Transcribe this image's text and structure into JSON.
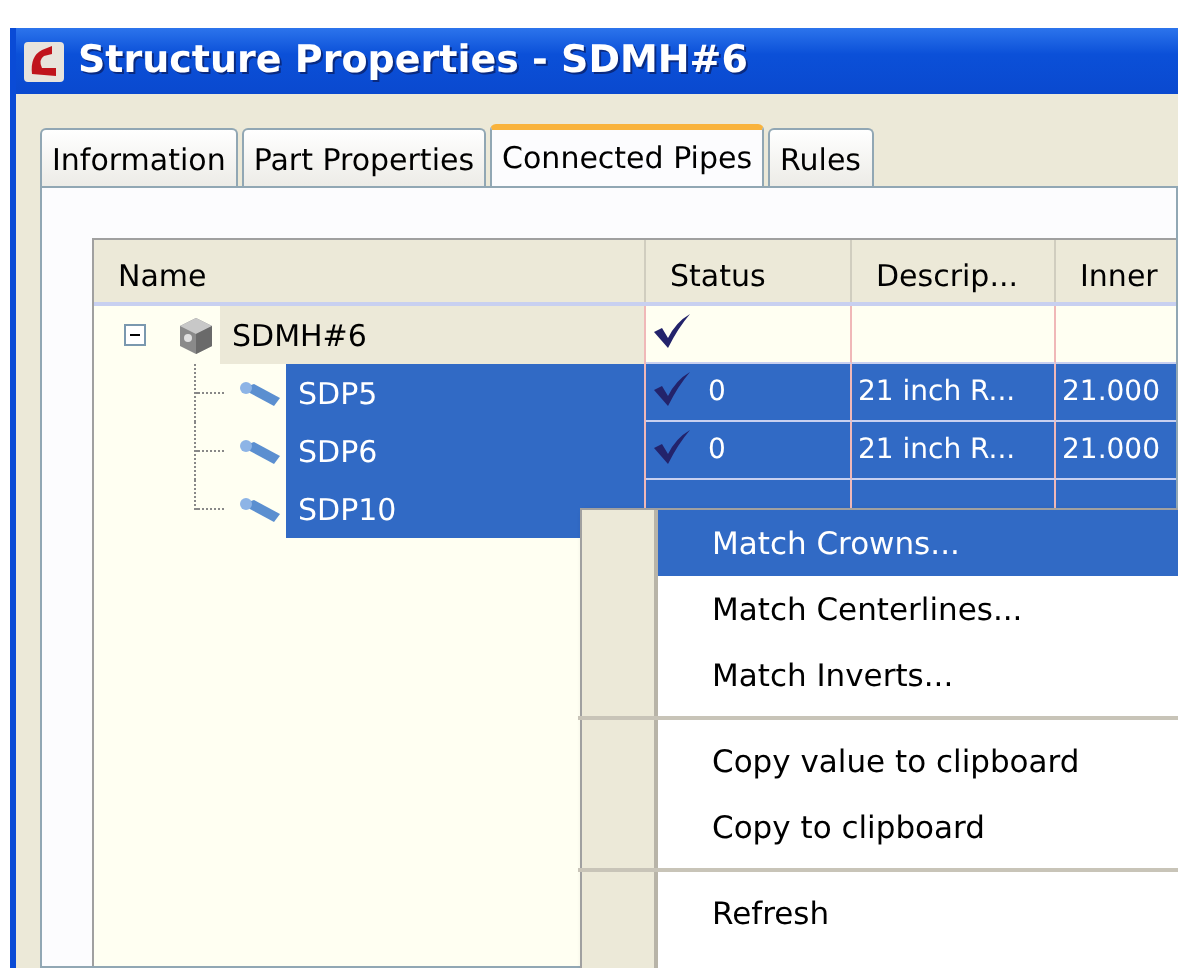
{
  "window": {
    "title": "Structure Properties - SDMH#6"
  },
  "tabs": [
    {
      "label": "Information",
      "selected": false
    },
    {
      "label": "Part Properties",
      "selected": false
    },
    {
      "label": "Connected Pipes",
      "selected": true
    },
    {
      "label": "Rules",
      "selected": false
    }
  ],
  "table": {
    "columns": [
      "Name",
      "Status",
      "Descrip...",
      "Inner"
    ],
    "rows": [
      {
        "name": "SDMH#6",
        "kind": "structure",
        "expanded": true,
        "selected": false,
        "status_ok": true,
        "children": [
          {
            "name": "SDP5",
            "kind": "pipe",
            "selected": true,
            "status_ok": true,
            "status": "0",
            "description": "21 inch R...",
            "inner": "21.000"
          },
          {
            "name": "SDP6",
            "kind": "pipe",
            "selected": true,
            "status_ok": true,
            "status": "0",
            "description": "21 inch R...",
            "inner": "21.000"
          },
          {
            "name": "SDP10",
            "kind": "pipe",
            "selected": true
          }
        ]
      }
    ]
  },
  "context_menu": {
    "groups": [
      [
        {
          "label": "Match Crowns...",
          "selected": true
        },
        {
          "label": "Match Centerlines...",
          "selected": false
        },
        {
          "label": "Match Inverts...",
          "selected": false
        }
      ],
      [
        {
          "label": "Copy value to clipboard",
          "selected": false
        },
        {
          "label": "Copy to clipboard",
          "selected": false
        }
      ],
      [
        {
          "label": "Refresh",
          "selected": false
        }
      ]
    ]
  }
}
